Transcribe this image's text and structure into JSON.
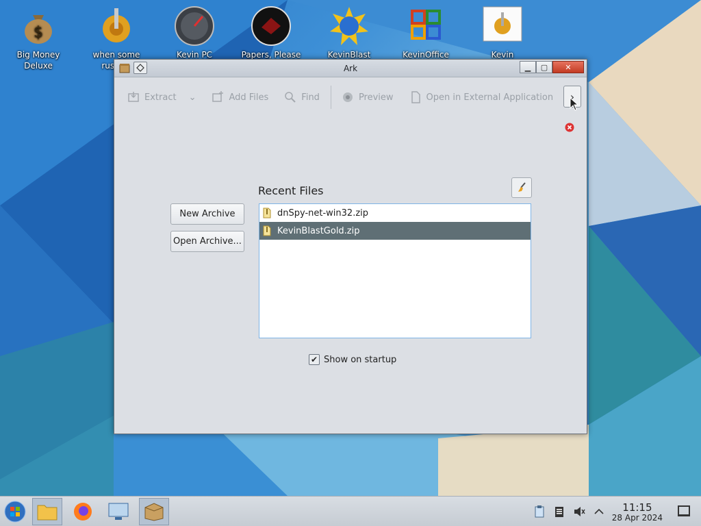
{
  "desktop": {
    "icons": [
      {
        "label": "Big Money Deluxe"
      },
      {
        "label": "when some russian"
      },
      {
        "label": "Kevin PC Optimizer Ho..."
      },
      {
        "label": "Papers, Please"
      },
      {
        "label": "KevinBlast Launcher"
      },
      {
        "label": "KevinOffice 2009"
      },
      {
        "label": "Kevin PCOptimizer..."
      }
    ]
  },
  "window": {
    "title": "Ark",
    "toolbar": {
      "extract": "Extract",
      "add_files": "Add Files",
      "find": "Find",
      "preview": "Preview",
      "open_external": "Open in External Application"
    },
    "new_archive": "New Archive",
    "open_archive": "Open Archive...",
    "recent_title": "Recent Files",
    "recent_files": [
      {
        "name": "dnSpy-net-win32.zip"
      },
      {
        "name": "KevinBlastGold.zip"
      }
    ],
    "show_on_startup": "Show on startup"
  },
  "taskbar": {
    "time": "11:15",
    "date": "28 Apr 2024"
  },
  "colors": {
    "selection": "#5f6f75",
    "list_border": "#7eb4e6",
    "close_button": "#c33b23"
  }
}
